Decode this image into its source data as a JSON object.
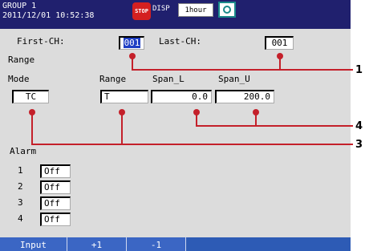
{
  "header": {
    "group": "GROUP 1",
    "datetime": "2011/12/01 10:52:38",
    "stop_label": "STOP",
    "disp_label": "DISP",
    "time_div": "1hour",
    "disk_icon": "disk-icon"
  },
  "channels": {
    "first_label": "First-CH:",
    "first_value": "001",
    "last_label": "Last-CH:",
    "last_value": "001"
  },
  "range": {
    "section_label": "Range",
    "mode_label": "Mode",
    "mode_value": "TC",
    "range_label": "Range",
    "range_value": "T",
    "span_l_label": "Span_L",
    "span_l_value": "0.0",
    "span_u_label": "Span_U",
    "span_u_value": "200.0"
  },
  "alarm": {
    "section_label": "Alarm",
    "items": [
      {
        "index": "1",
        "value": "Off"
      },
      {
        "index": "2",
        "value": "Off"
      },
      {
        "index": "3",
        "value": "Off"
      },
      {
        "index": "4",
        "value": "Off"
      }
    ]
  },
  "softkeys": [
    "Input",
    "+1",
    "-1"
  ],
  "callouts": [
    "1",
    "4",
    "3"
  ],
  "colors": {
    "header_bg": "#20206e",
    "screen_bg": "#dcdcdc",
    "callout_line": "#c4202a",
    "selection": "#1f3fc4",
    "softkey_bg": "#3b66c4"
  }
}
